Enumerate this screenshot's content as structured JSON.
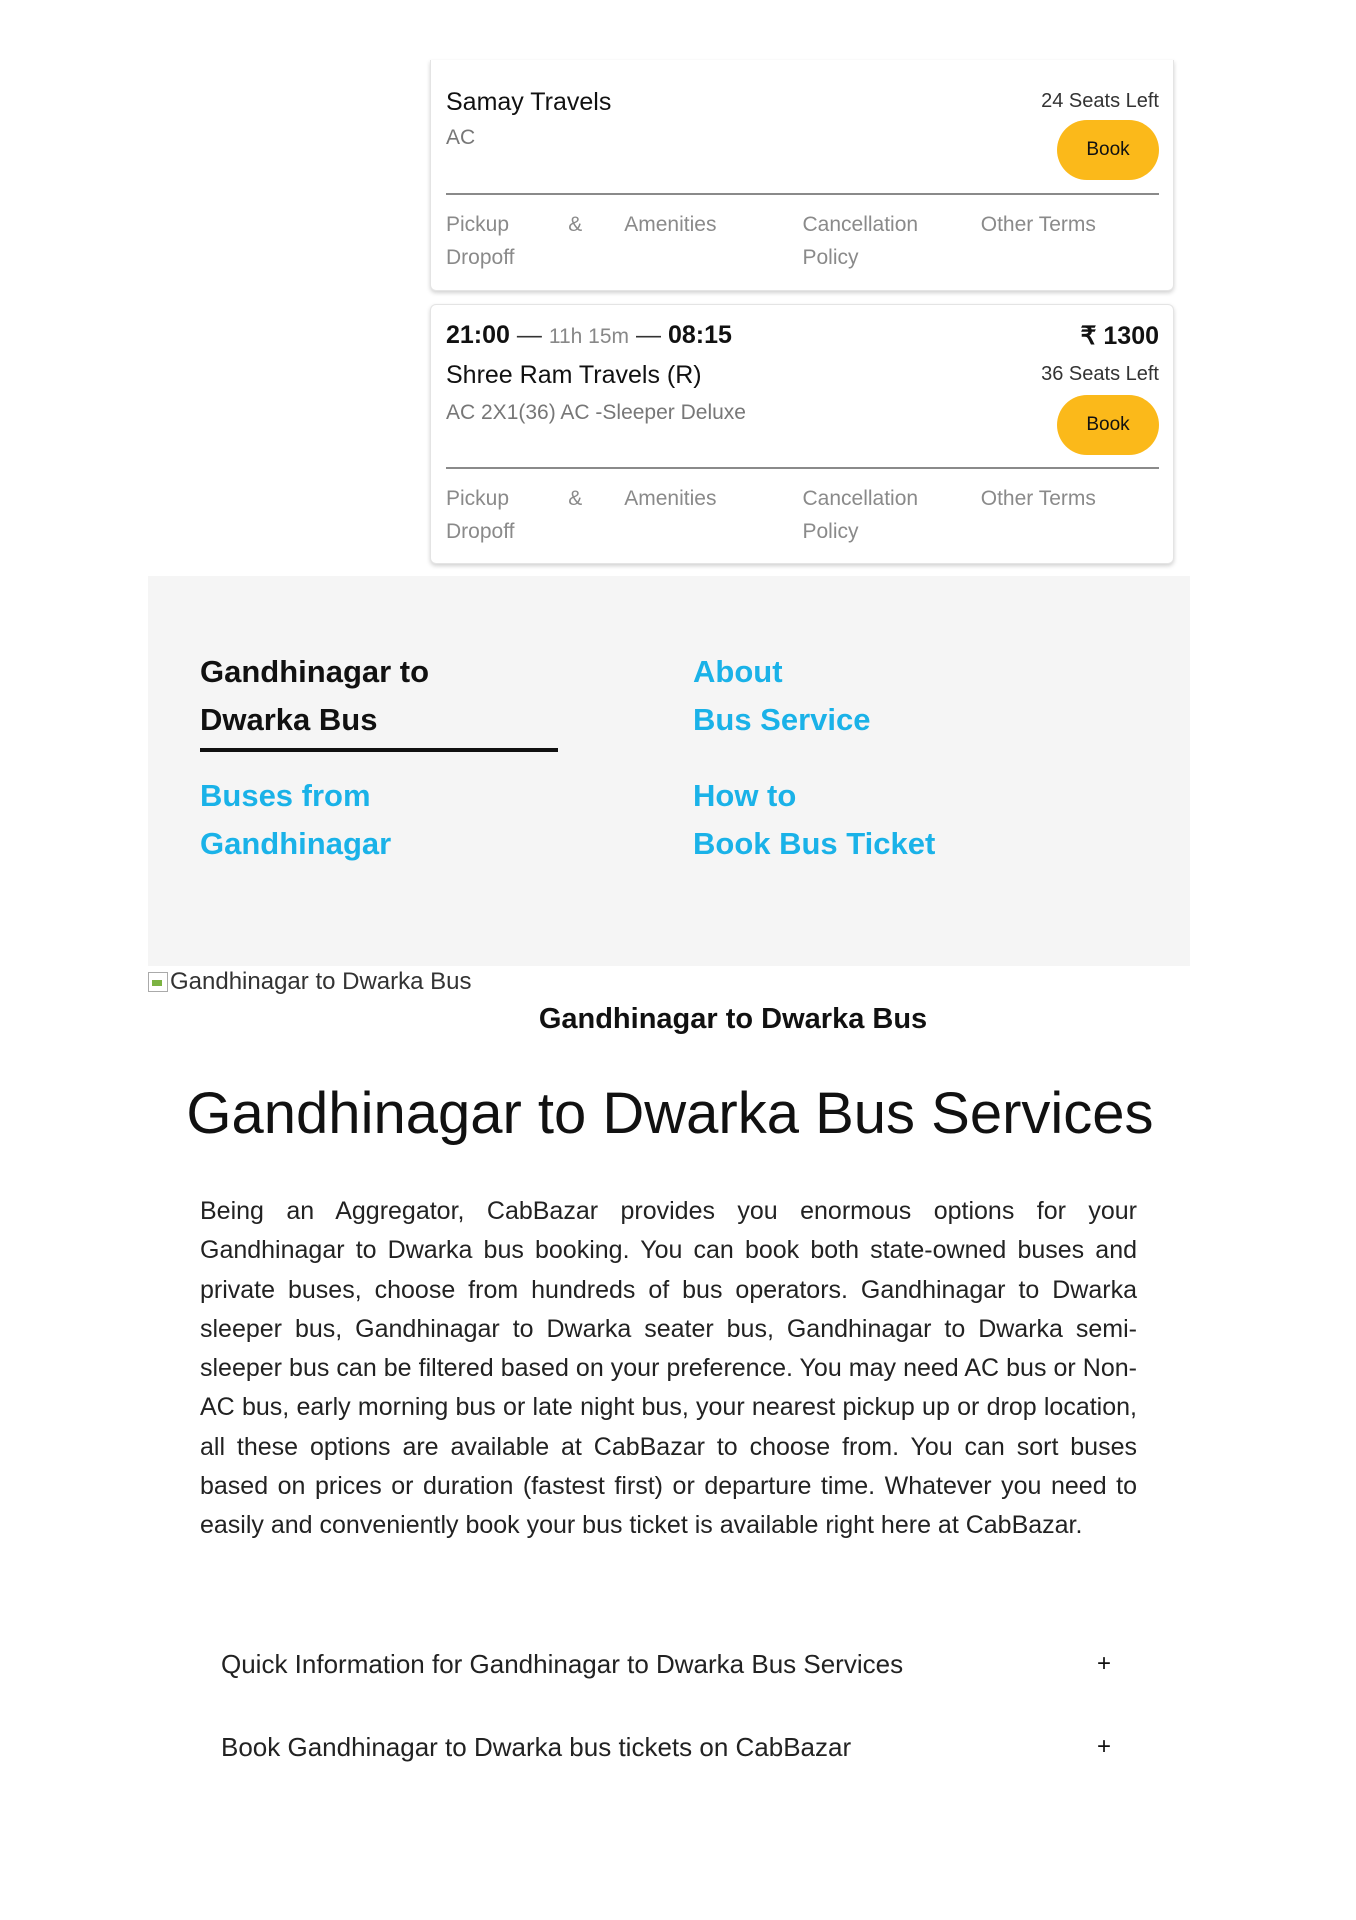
{
  "listings": [
    {
      "operator": "Samay Travels",
      "bus_type": "AC",
      "seats_left": "24 Seats Left",
      "book_label": "Book",
      "tabs": {
        "pickup": "Pickup",
        "amp": "&",
        "dropoff": "Dropoff",
        "amenities": "Amenities",
        "cancellation": "Cancellation",
        "policy": "Policy",
        "other_terms": "Other Terms"
      }
    },
    {
      "departure": "21:00",
      "duration": "11h 15m",
      "arrival": "08:15",
      "price": "₹ 1300",
      "operator": "Shree Ram Travels (R)",
      "bus_type": "AC 2X1(36) AC -Sleeper Deluxe",
      "seats_left": "36 Seats Left",
      "book_label": "Book",
      "tabs": {
        "pickup": "Pickup",
        "amp": "&",
        "dropoff": "Dropoff",
        "amenities": "Amenities",
        "cancellation": "Cancellation",
        "policy": "Policy",
        "other_terms": "Other Terms"
      }
    }
  ],
  "route_links": {
    "active": {
      "line1": "Gandhinagar to",
      "line2": "Dwarka Bus"
    },
    "about": {
      "line1": "About",
      "line2": "Bus Service"
    },
    "buses_from": {
      "line1": "Buses from",
      "line2": "Gandhinagar"
    },
    "how_to": {
      "line1": "How to",
      "line2": "Book Bus Ticket"
    }
  },
  "image_alt": "Gandhinagar to Dwarka Bus",
  "image_caption": "Gandhinagar to Dwarka Bus",
  "section_title": "Gandhinagar to Dwarka Bus Services",
  "description": "Being an Aggregator, CabBazar provides you enormous options for your Gandhinagar to Dwarka bus booking. You can book both state-owned buses and private buses, choose from hundreds of bus operators. Gandhinagar to Dwarka sleeper bus, Gandhinagar to Dwarka seater bus, Gandhinagar to Dwarka semi-sleeper bus can be filtered based on your preference. You may need AC bus or Non-AC bus, early morning bus or late night bus, your nearest pickup up or drop location, all these options are available at CabBazar to choose from. You can sort buses based on prices or duration (fastest first) or departure time. Whatever you need to easily and conveniently book your bus ticket is available right here at CabBazar.",
  "accordion": [
    {
      "label": "Quick Information for Gandhinagar to Dwarka Bus Services",
      "toggle": "+"
    },
    {
      "label": "Book Gandhinagar to Dwarka bus tickets on CabBazar",
      "toggle": "+"
    }
  ],
  "colors": {
    "accent_yellow": "#fbb91a",
    "link_blue": "#1ab2e8",
    "panel_bg": "#f5f5f5"
  }
}
